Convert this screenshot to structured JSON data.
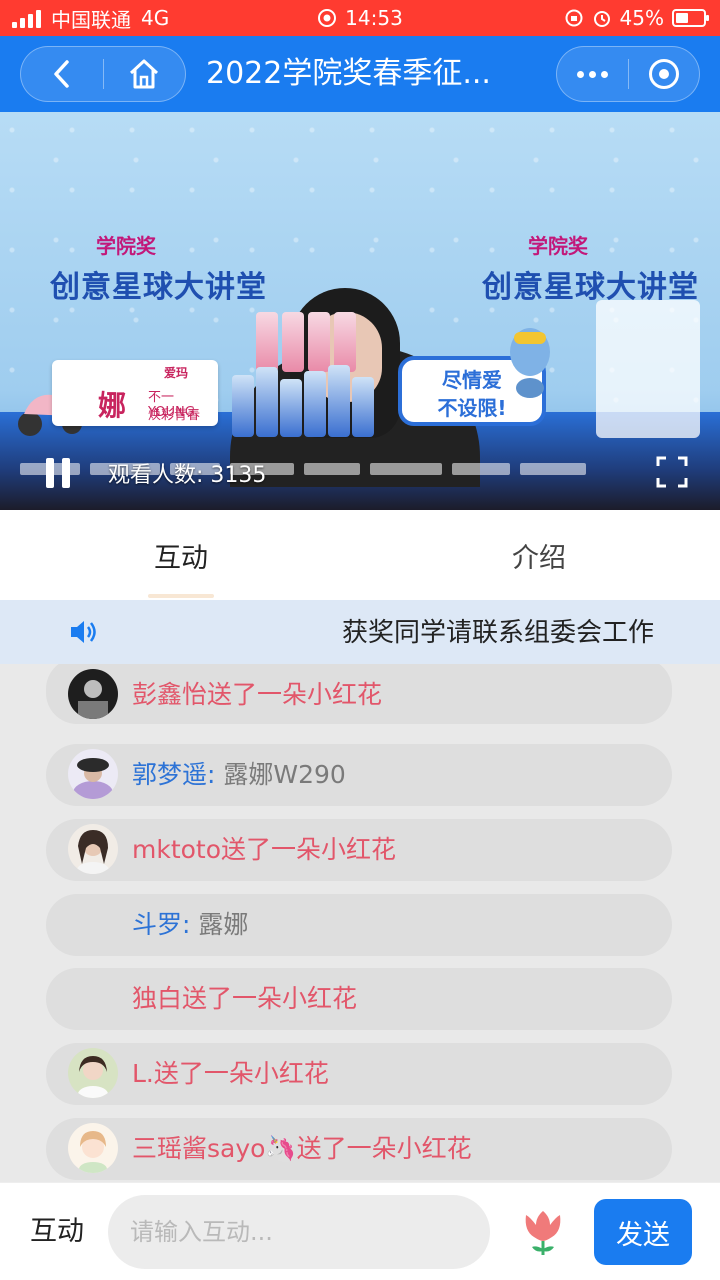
{
  "status_bar": {
    "carrier": "中国联通",
    "network": "4G",
    "time": "14:53",
    "battery": "45%",
    "battery_level": 0.45
  },
  "nav": {
    "title": "2022学院奖春季征..."
  },
  "video": {
    "board_title": "创意星球大讲堂",
    "board_sub": "学院奖",
    "slogan_line1": "尽情爱",
    "slogan_line2": "不设限!",
    "sponsor_big": "娜",
    "sponsor_small1": "不一YOUNG",
    "sponsor_small2": "焕彩青春",
    "sponsor_brand": "爱玛",
    "viewers_label": "观看人数:",
    "viewers_count": "3135"
  },
  "tabs": [
    {
      "label": "互动"
    },
    {
      "label": "介绍"
    }
  ],
  "notice": {
    "text": "获奖同学请联系组委会工作"
  },
  "chat": [
    {
      "type": "gift",
      "text": "彭鑫怡送了一朵小红花",
      "avatar": "dark"
    },
    {
      "type": "message",
      "user": "郭梦遥:",
      "text": "露娜W290",
      "avatar": "hat"
    },
    {
      "type": "gift",
      "text": "mktoto送了一朵小红花",
      "avatar": "photo"
    },
    {
      "type": "message",
      "user": "斗罗:",
      "text": "露娜",
      "avatar": "none"
    },
    {
      "type": "gift",
      "text": "独白送了一朵小红花",
      "avatar": "none"
    },
    {
      "type": "gift",
      "text": "L.送了一朵小红花",
      "avatar": "girl"
    },
    {
      "type": "gift",
      "text": "三瑶酱sayo🦄送了一朵小红花",
      "avatar": "cartoon"
    }
  ],
  "bottom": {
    "label": "互动",
    "input_placeholder": "请输入互动...",
    "send_label": "发送"
  },
  "colors": {
    "primary": "#1a7cf0",
    "status_bar": "#ff3b30",
    "gift_text": "#e2566a",
    "username": "#2d73d6"
  }
}
